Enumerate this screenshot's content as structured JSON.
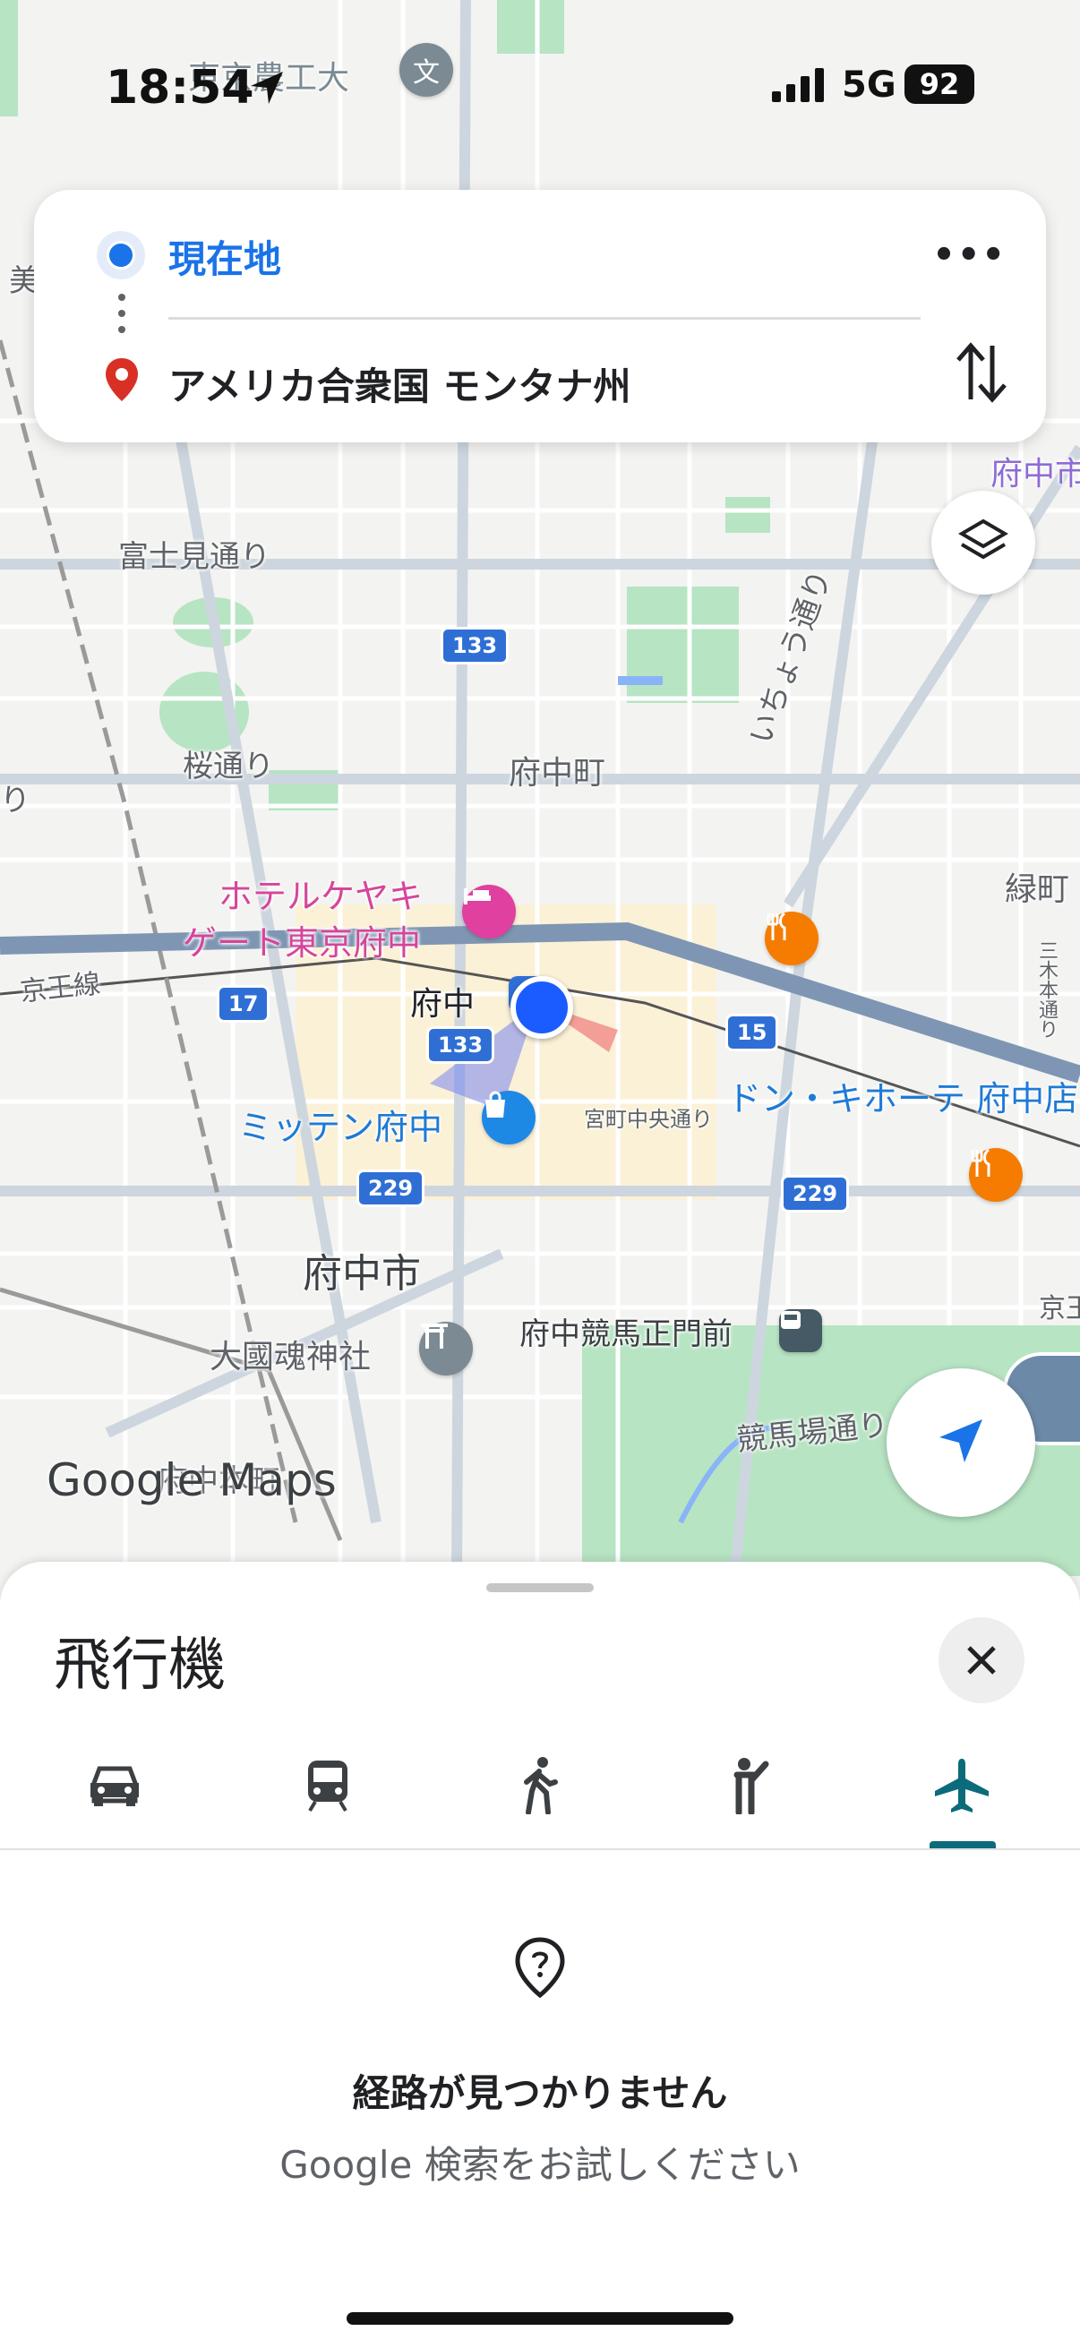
{
  "status_bar": {
    "time": "18:54",
    "network": "5G",
    "battery": "92"
  },
  "route": {
    "origin": "現在地",
    "destination": "アメリカ合衆国 モンタナ州"
  },
  "map": {
    "labels": [
      {
        "text": "東京農工大",
        "name": "label-noko-univ"
      },
      {
        "text": "富士見通り",
        "name": "label-fujimi-dori"
      },
      {
        "text": "桜通り",
        "name": "label-sakura-dori"
      },
      {
        "text": "府中町",
        "name": "label-fuchu-cho"
      },
      {
        "text": "ホテルケヤキ",
        "name": "label-hotel-1"
      },
      {
        "text": "ゲート東京府中",
        "name": "label-hotel-2"
      },
      {
        "text": "京王線",
        "name": "label-keio-line"
      },
      {
        "text": "府中",
        "name": "label-fuchu-station"
      },
      {
        "text": "ミッテン府中",
        "name": "label-mitten"
      },
      {
        "text": "宮町中央通り",
        "name": "label-miyamachi"
      },
      {
        "text": "ドン・キホーテ 府中店",
        "name": "label-donki"
      },
      {
        "text": "府中市",
        "name": "label-fuchu-shi"
      },
      {
        "text": "大國魂神社",
        "name": "label-okunitama"
      },
      {
        "text": "府中競馬正門前",
        "name": "label-keiba-seimon"
      },
      {
        "text": "競馬場通り",
        "name": "label-keibajo-dori"
      },
      {
        "text": "いちょう通り",
        "name": "label-icho-dori"
      },
      {
        "text": "緑町",
        "name": "label-midori-cho"
      },
      {
        "text": "府中市",
        "name": "label-fuchu-shi-2"
      },
      {
        "text": "三木本通り",
        "name": "label-sanbon"
      },
      {
        "text": "府中本町",
        "name": "label-fuchu-honmachi"
      },
      {
        "text": "美",
        "name": "label-edge-1"
      },
      {
        "text": "り",
        "name": "label-edge-2"
      },
      {
        "text": "京王",
        "name": "label-edge-3"
      }
    ],
    "shields": [
      "133",
      "133",
      "17",
      "15",
      "229",
      "229"
    ],
    "logo": "Google Maps"
  },
  "sheet": {
    "title": "飛行機",
    "tabs": [
      "car",
      "transit",
      "walk",
      "ride",
      "flight"
    ],
    "active_tab": "flight",
    "message_title": "経路が見つかりません",
    "message_sub": "Google 検索をお試しください"
  },
  "colors": {
    "accent": "#1a73e8",
    "active_tab": "#0b6b7a",
    "poi_food": "#f57c00",
    "poi_hotel": "#e040a0",
    "poi_shop": "#1e88e5",
    "poi_landmark": "#7b8a93"
  }
}
